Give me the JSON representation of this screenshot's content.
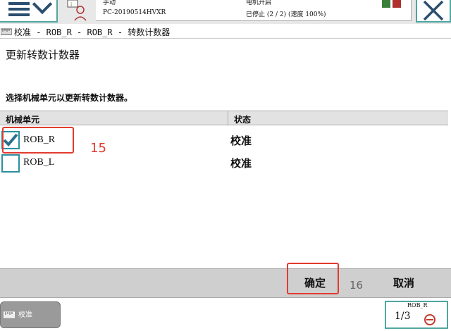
{
  "status_bar": {
    "mode": "手动",
    "system_name": "PC-20190514HVXR",
    "motor_state": "电机开启",
    "program_state": "已停止 (2 / 2) (速度 100%)"
  },
  "breadcrumb": "校准 - ROB_R - ROB_R - 转数计数器",
  "page_title": "更新转数计数器",
  "instruction": "选择机械单元以更新转数计数器。",
  "table": {
    "headers": [
      "机械单元",
      "状态"
    ],
    "rows": [
      {
        "unit": "ROB_R",
        "status": "校准",
        "checked": true
      },
      {
        "unit": "ROB_L",
        "status": "校准",
        "checked": false
      }
    ]
  },
  "annotations": {
    "first": "15",
    "second": "16"
  },
  "actions": {
    "ok": "确定",
    "cancel": "取消"
  },
  "taskbar": {
    "item": "校准"
  },
  "quickset": {
    "unit": "ROB_R",
    "fraction": "1/3"
  },
  "colors": {
    "accent": "#4fa6a0",
    "annotation": "#e23a2e",
    "checkbox": "#2a8fa0"
  }
}
